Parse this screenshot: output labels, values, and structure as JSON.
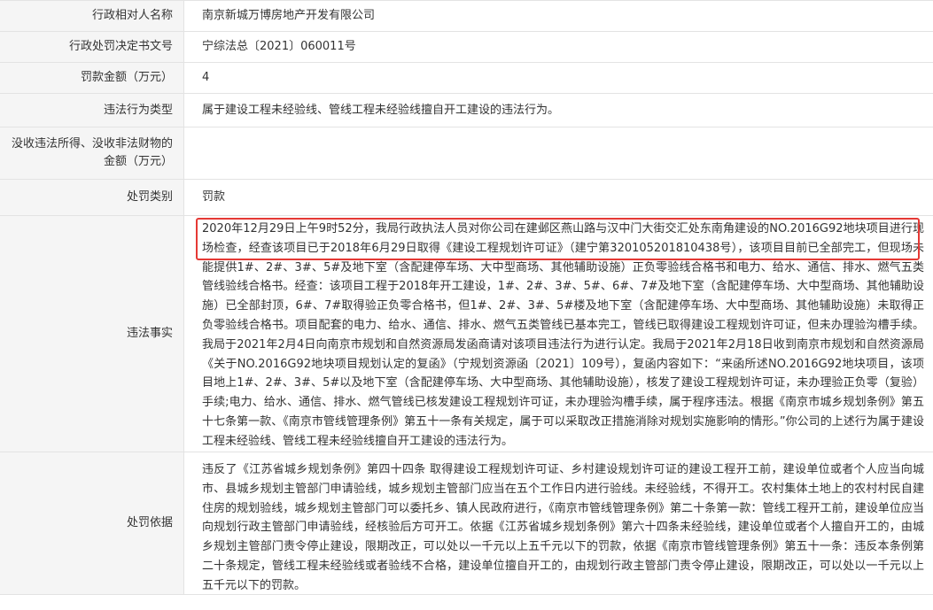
{
  "rows": [
    {
      "label": "行政相对人名称",
      "value": "南京新城万博房地产开发有限公司"
    },
    {
      "label": "行政处罚决定书文号",
      "value": "宁综法总〔2021〕060011号"
    },
    {
      "label": "罚款金额（万元）",
      "value": "4"
    },
    {
      "label": "违法行为类型",
      "value": "属于建设工程未经验线、管线工程未经验线擅自开工建设的违法行为。"
    },
    {
      "label": "没收违法所得、没收非法财物的金额（万元）",
      "value": ""
    },
    {
      "label": "处罚类别",
      "value": "罚款"
    },
    {
      "label": "违法事实",
      "value": "2020年12月29日上午9时52分，我局行政执法人员对你公司在建邺区燕山路与汉中门大街交汇处东南角建设的NO.2016G92地块项目进行现场检查，经查该项目已于2018年6月29日取得《建设工程规划许可证》（建宁第320105201810438号），该项目目前已全部完工，但现场未能提供1#、2#、3#、5#及地下室（含配建停车场、大中型商场、其他辅助设施）正负零验线合格书和电力、给水、通信、排水、燃气五类管线验线合格书。经查：该项目工程于2018年开工建设，1#、2#、3#、5#、6#、7#及地下室（含配建停车场、大中型商场、其他辅助设施）已全部封顶，6#、7#取得验正负零合格书，但1#、2#、3#、5#楼及地下室（含配建停车场、大中型商场、其他辅助设施）未取得正负零验线合格书。项目配套的电力、给水、通信、排水、燃气五类管线已基本完工，管线已取得建设工程规划许可证，但未办理验沟槽手续。我局于2021年2月4日向南京市规划和自然资源局发函商请对该项目违法行为进行认定。我局于2021年2月18日收到南京市规划和自然资源局《关于NO.2016G92地块项目规划认定的复函》（宁规划资源函〔2021〕109号），复函内容如下：“来函所述NO.2016G92地块项目，该项目地上1#、2#、3#、5#以及地下室（含配建停车场、大中型商场、其他辅助设施），核发了建设工程规划许可证，未办理验正负零（复验）手续;电力、给水、通信、排水、燃气管线已核发建设工程规划许可证，未办理验沟槽手续，属于程序违法。根据《南京市城乡规划条例》第五十七条第一款、《南京市管线管理条例》第五十一条有关规定，属于可以采取改正措施消除对规划实施影响的情形。”你公司的上述行为属于建设工程未经验线、管线工程未经验线擅自开工建设的违法行为。"
    },
    {
      "label": "处罚依据",
      "value": "违反了《江苏省城乡规划条例》第四十四条 取得建设工程规划许可证、乡村建设规划许可证的建设工程开工前，建设单位或者个人应当向城市、县城乡规划主管部门申请验线，城乡规划主管部门应当在五个工作日内进行验线。未经验线，不得开工。农村集体土地上的农村村民自建住房的规划验线，城乡规划主管部门可以委托乡、镇人民政府进行，《南京市管线管理条例》第二十条第一款：管线工程开工前，建设单位应当向规划行政主管部门申请验线，经核验后方可开工。依据《江苏省城乡规划条例》第六十四条未经验线，建设单位或者个人擅自开工的，由城乡规划主管部门责令停止建设，限期改正，可以处以一千元以上五千元以下的罚款，依据《南京市管线管理条例》第五十一条：违反本条例第二十条规定，管线工程未经验线或者验线不合格，建设单位擅自开工的，由规划行政主管部门责令停止建设，限期改正，可以处以一千元以上五千元以下的罚款。"
    }
  ],
  "highlight_color": "#e53935"
}
